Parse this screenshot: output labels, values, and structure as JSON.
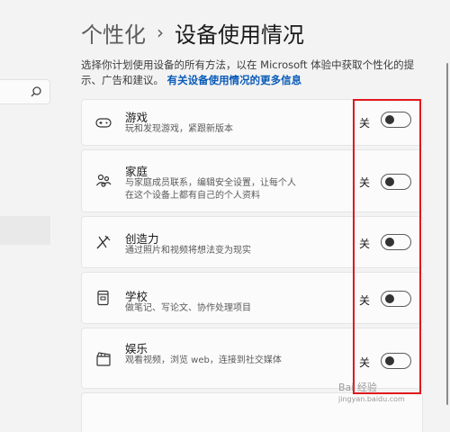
{
  "breadcrumb": {
    "parent": "个性化",
    "separator": "›",
    "current": "设备使用情况"
  },
  "description": {
    "text": "选择你计划使用设备的所有方法，以在 Microsoft 体验中获取个性化的提示、广告和建议。",
    "link": "有关设备使用情况的更多信息"
  },
  "cards": [
    {
      "icon": "gamepad-icon",
      "title": "游戏",
      "subtitle": "玩和发现游戏，紧跟新版本",
      "state": "关",
      "on": false
    },
    {
      "icon": "family-icon",
      "title": "家庭",
      "subtitle": "与家庭成员联系，编辑安全设置，让每个人在这个设备上都有自己的个人资料",
      "state": "关",
      "on": false
    },
    {
      "icon": "creativity-icon",
      "title": "创造力",
      "subtitle": "通过照片和视频将想法变为现实",
      "state": "关",
      "on": false
    },
    {
      "icon": "school-icon",
      "title": "学校",
      "subtitle": "做笔记、写论文、协作处理项目",
      "state": "关",
      "on": false
    },
    {
      "icon": "entertainment-icon",
      "title": "娱乐",
      "subtitle": "观看视频，浏览 web，连接到社交媒体",
      "state": "关",
      "on": false
    }
  ],
  "watermark": {
    "line1": "Bai 经验",
    "line2": "jingyan.baidu.com"
  },
  "colors": {
    "highlight": "#e0191e",
    "link": "#0a5bb8"
  }
}
